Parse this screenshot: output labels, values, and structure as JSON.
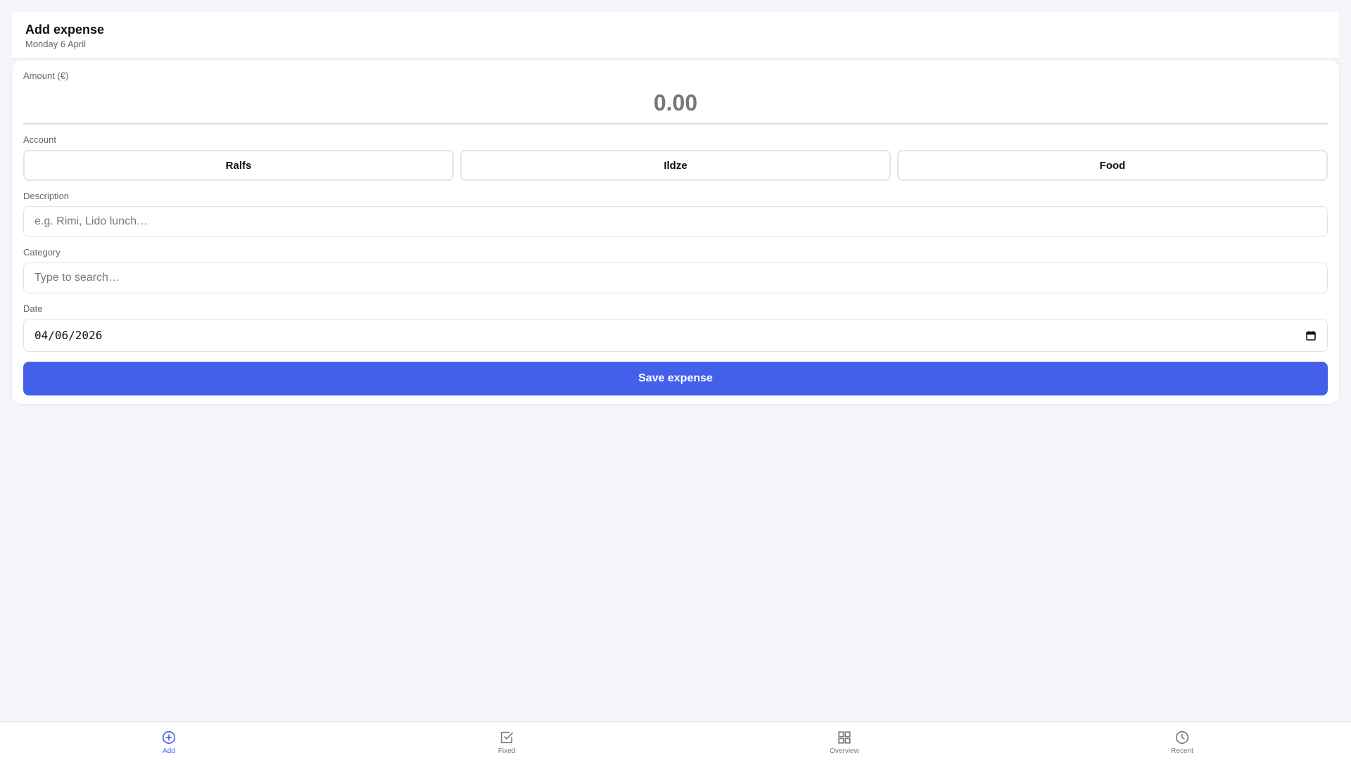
{
  "header": {
    "title": "Add expense",
    "date": "Monday 6 April"
  },
  "form": {
    "amount_label": "Amount (€)",
    "amount_value": "0.00",
    "account_label": "Account",
    "accounts": [
      "Ralfs",
      "Ildze",
      "Food"
    ],
    "description_label": "Description",
    "description_placeholder": "e.g. Rimi, Lido lunch…",
    "category_label": "Category",
    "category_placeholder": "Type to search…",
    "date_label": "Date",
    "date_value": "04/06/2026",
    "save_label": "Save expense"
  },
  "nav": {
    "items": [
      {
        "label": "Add",
        "icon": "plus-circle-icon",
        "active": true
      },
      {
        "label": "Fixed",
        "icon": "check-square-icon",
        "active": false
      },
      {
        "label": "Overview",
        "icon": "grid-icon",
        "active": false
      },
      {
        "label": "Recent",
        "icon": "clock-icon",
        "active": false
      }
    ]
  },
  "colors": {
    "accent": "#4460ea",
    "background": "#f4f5f8"
  }
}
